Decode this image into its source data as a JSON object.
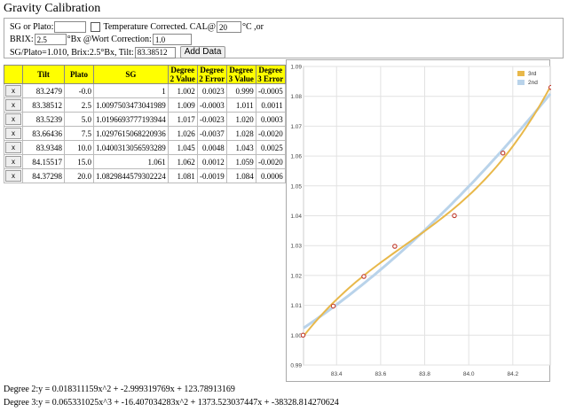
{
  "title": "Gravity Calibration",
  "form": {
    "sg_label": "SG or Plato:",
    "sg_value": "",
    "temp_label": "Temperature Corrected. CAL@",
    "temp_value": "20",
    "temp_unit": "°C ,or",
    "brix_label": "BRIX:",
    "brix_value": "2.5",
    "brix_unit": "°Bx @Wort Correction:",
    "wort_value": "1.0",
    "summary": "SG/Plato=1.010, Brix:2.5°Bx, Tilt:",
    "tilt_value": "83.38512",
    "add_label": "Add Data"
  },
  "table": {
    "headers": [
      "",
      "Tilt",
      "Plato",
      "SG",
      "Degree 2 Value",
      "Degree 2 Error",
      "Degree 3 Value",
      "Degree 3 Error"
    ],
    "rows": [
      [
        "x",
        "83.2479",
        "-0.0",
        "1",
        "1.002",
        "0.0023",
        "0.999",
        "-0.0005"
      ],
      [
        "x",
        "83.38512",
        "2.5",
        "1.0097503473041989",
        "1.009",
        "-0.0003",
        "1.011",
        "0.0011"
      ],
      [
        "x",
        "83.5239",
        "5.0",
        "1.0196693777193944",
        "1.017",
        "-0.0023",
        "1.020",
        "0.0003"
      ],
      [
        "x",
        "83.66436",
        "7.5",
        "1.0297615068220936",
        "1.026",
        "-0.0037",
        "1.028",
        "-0.0020"
      ],
      [
        "x",
        "83.9348",
        "10.0",
        "1.0400313056593289",
        "1.045",
        "0.0048",
        "1.043",
        "0.0025"
      ],
      [
        "x",
        "84.15517",
        "15.0",
        "1.061",
        "1.062",
        "0.0012",
        "1.059",
        "-0.0020"
      ],
      [
        "x",
        "84.37298",
        "20.0",
        "1.0829844579302224",
        "1.081",
        "-0.0019",
        "1.084",
        "0.0006"
      ]
    ]
  },
  "chart_data": {
    "type": "line",
    "xlim": [
      83.25,
      84.37
    ],
    "ylim": [
      0.99,
      1.09
    ],
    "xticks": [
      "83.4",
      "83.6",
      "83.8",
      "84.0",
      "84.2"
    ],
    "yticks": [
      "0.99",
      "1.00",
      "1.01",
      "1.02",
      "1.03",
      "1.04",
      "1.05",
      "1.06",
      "1.07",
      "1.08",
      "1.09"
    ],
    "grid": true,
    "legend_position": "top-right",
    "points": {
      "x": [
        83.2479,
        83.38512,
        83.5239,
        83.66436,
        83.9348,
        84.15517,
        84.37298
      ],
      "y": [
        1.0,
        1.0097503473041989,
        1.0196693777193944,
        1.0297615068220936,
        1.0400313056593289,
        1.061,
        1.0829844579302224
      ]
    },
    "series": [
      {
        "name": "3rd",
        "color": "#e8b84a",
        "coef": [
          0.065331025,
          -16.407034283,
          1373.523037447,
          -38328.814270624
        ]
      },
      {
        "name": "2nd",
        "color": "#b9d3ea",
        "coef": [
          0,
          0.018311159,
          -2.999319769,
          123.78913169
        ]
      }
    ],
    "point_color": "#c0392b"
  },
  "equations": {
    "deg2": "Degree 2:y = 0.018311159x^2 + -2.999319769x + 123.78913169",
    "deg3": "Degree 3:y = 0.065331025x^3 + -16.407034283x^2 + 1373.523037447x + -38328.814270624"
  }
}
